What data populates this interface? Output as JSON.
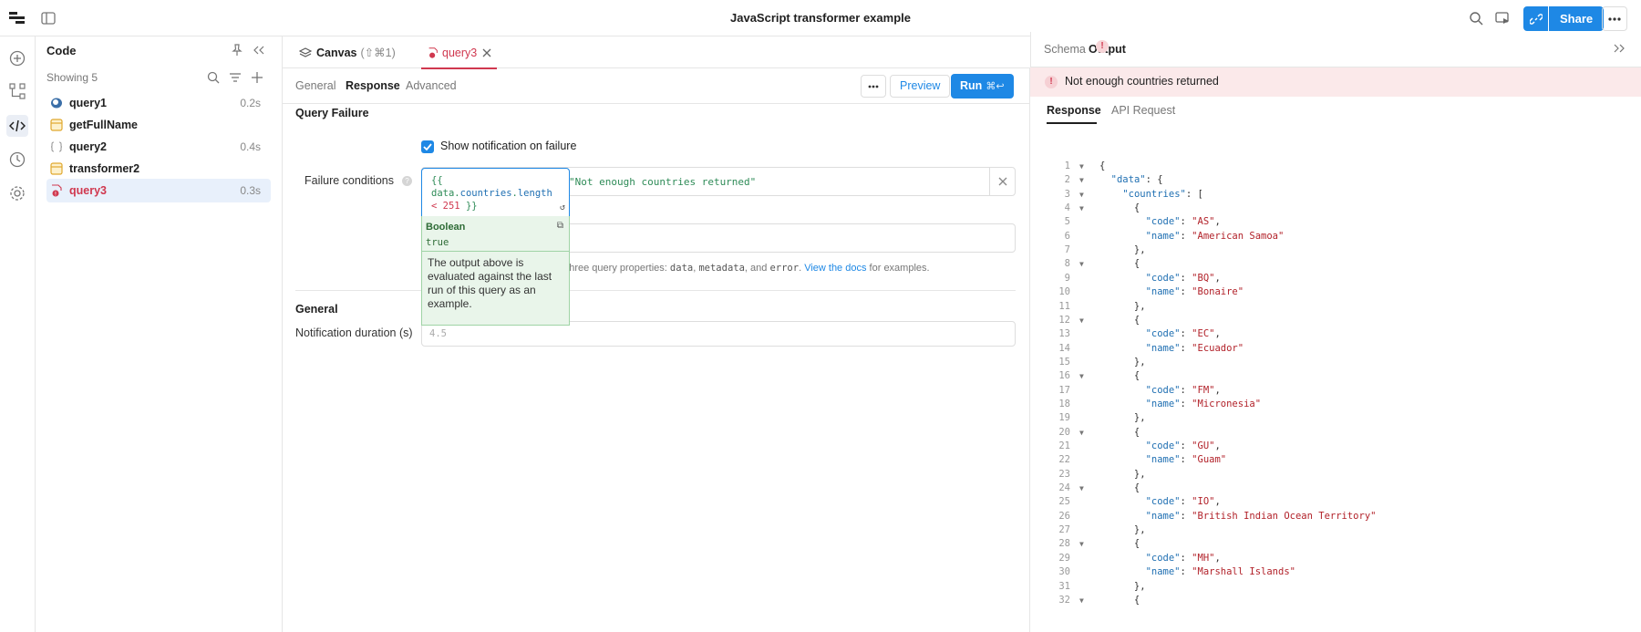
{
  "app": {
    "title": "JavaScript transformer example",
    "share_label": "Share"
  },
  "code_panel": {
    "title": "Code",
    "showing": "Showing 5",
    "queries": [
      {
        "name": "query1",
        "time": "0.2s",
        "icon": "postgres-icon"
      },
      {
        "name": "getFullName",
        "time": "",
        "icon": "transformer-icon"
      },
      {
        "name": "query2",
        "time": "0.4s",
        "icon": "js-query-icon"
      },
      {
        "name": "transformer2",
        "time": "",
        "icon": "transformer-icon"
      },
      {
        "name": "query3",
        "time": "0.3s",
        "icon": "js-error-icon"
      }
    ]
  },
  "editor": {
    "canvas_tab": "Canvas",
    "canvas_shortcut": "(⇧⌘1)",
    "query_tab": "query3",
    "subtabs": [
      "General",
      "Response",
      "Advanced"
    ],
    "preview_label": "Preview",
    "run_label": "Run",
    "run_shortcut": "⌘↩",
    "query_failure_heading": "Query Failure",
    "show_notification_label": "Show notification on failure",
    "failure_conditions_label": "Failure conditions",
    "failure_code": {
      "line1": "{{",
      "line2_obj": "data",
      "line2_prop1": "countries",
      "line2_prop2": "length",
      "line3_op": "<",
      "line3_num": "251",
      "line3_close": "}}"
    },
    "failure_message": "\"Not enough countries returned\"",
    "eval": {
      "type": "Boolean",
      "value": "true",
      "description": "The output above is evaluated against the last run of this query as an example."
    },
    "help": {
      "prefix": "o three query properties:",
      "c1": "data",
      "c2": "metadata",
      "and_text": ", and",
      "c3": "error",
      "link": "View the docs",
      "suffix": "for examples."
    },
    "general_heading": "General",
    "notification_duration_label": "Notification duration (s)",
    "notification_duration_placeholder": "4.5"
  },
  "output": {
    "tabs": [
      "Schema",
      "Output"
    ],
    "error_text": "Not enough countries returned",
    "response_tabs": [
      "Response",
      "API Request"
    ],
    "json_lines": [
      {
        "n": "1",
        "fold": true,
        "text": "{"
      },
      {
        "n": "2",
        "fold": true,
        "text": "  \"data\": {"
      },
      {
        "n": "3",
        "fold": true,
        "text": "    \"countries\": ["
      },
      {
        "n": "4",
        "fold": true,
        "text": "      {"
      },
      {
        "n": "5",
        "fold": false,
        "key": "code",
        "val": "AS",
        "indent": "        ",
        "end": ","
      },
      {
        "n": "6",
        "fold": false,
        "key": "name",
        "val": "American Samoa",
        "indent": "        ",
        "end": ""
      },
      {
        "n": "7",
        "fold": false,
        "text": "      },"
      },
      {
        "n": "8",
        "fold": true,
        "text": "      {"
      },
      {
        "n": "9",
        "fold": false,
        "key": "code",
        "val": "BQ",
        "indent": "        ",
        "end": ","
      },
      {
        "n": "10",
        "fold": false,
        "key": "name",
        "val": "Bonaire",
        "indent": "        ",
        "end": ""
      },
      {
        "n": "11",
        "fold": false,
        "text": "      },"
      },
      {
        "n": "12",
        "fold": true,
        "text": "      {"
      },
      {
        "n": "13",
        "fold": false,
        "key": "code",
        "val": "EC",
        "indent": "        ",
        "end": ","
      },
      {
        "n": "14",
        "fold": false,
        "key": "name",
        "val": "Ecuador",
        "indent": "        ",
        "end": ""
      },
      {
        "n": "15",
        "fold": false,
        "text": "      },"
      },
      {
        "n": "16",
        "fold": true,
        "text": "      {"
      },
      {
        "n": "17",
        "fold": false,
        "key": "code",
        "val": "FM",
        "indent": "        ",
        "end": ","
      },
      {
        "n": "18",
        "fold": false,
        "key": "name",
        "val": "Micronesia",
        "indent": "        ",
        "end": ""
      },
      {
        "n": "19",
        "fold": false,
        "text": "      },"
      },
      {
        "n": "20",
        "fold": true,
        "text": "      {"
      },
      {
        "n": "21",
        "fold": false,
        "key": "code",
        "val": "GU",
        "indent": "        ",
        "end": ","
      },
      {
        "n": "22",
        "fold": false,
        "key": "name",
        "val": "Guam",
        "indent": "        ",
        "end": ""
      },
      {
        "n": "23",
        "fold": false,
        "text": "      },"
      },
      {
        "n": "24",
        "fold": true,
        "text": "      {"
      },
      {
        "n": "25",
        "fold": false,
        "key": "code",
        "val": "IO",
        "indent": "        ",
        "end": ","
      },
      {
        "n": "26",
        "fold": false,
        "key": "name",
        "val": "British Indian Ocean Territory",
        "indent": "        ",
        "end": ""
      },
      {
        "n": "27",
        "fold": false,
        "text": "      },"
      },
      {
        "n": "28",
        "fold": true,
        "text": "      {"
      },
      {
        "n": "29",
        "fold": false,
        "key": "code",
        "val": "MH",
        "indent": "        ",
        "end": ","
      },
      {
        "n": "30",
        "fold": false,
        "key": "name",
        "val": "Marshall Islands",
        "indent": "        ",
        "end": ""
      },
      {
        "n": "31",
        "fold": false,
        "text": "      },"
      },
      {
        "n": "32",
        "fold": true,
        "text": "      {"
      }
    ]
  },
  "colors": {
    "accent": "#1e88e5",
    "error": "#d0384f",
    "success_bg": "#e9f5ea"
  }
}
